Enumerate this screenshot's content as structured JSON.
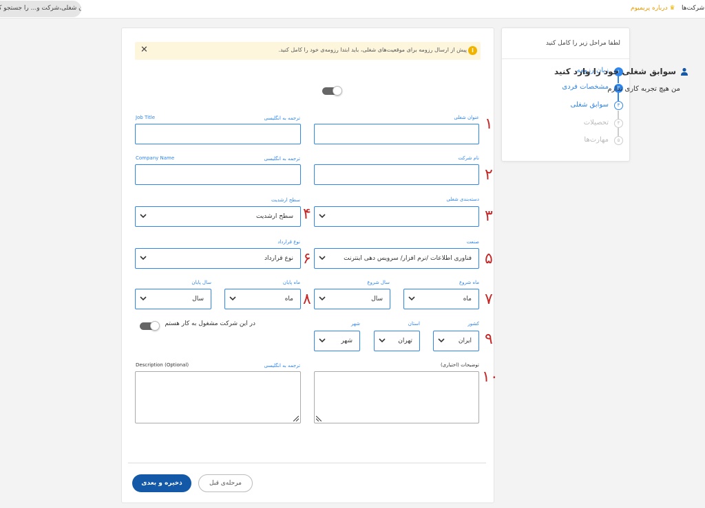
{
  "topbar": {
    "search_text": "عنوان شغلی،شرکت و... را جستجو کنید",
    "nav_companies": "شرکت‌ها",
    "premium_label": "درباره پریمیوم",
    "premium_icon": "crown-icon"
  },
  "steps": {
    "heading": "لطفا مراحل زیر را کامل کنید",
    "items": [
      {
        "num": "۱",
        "label": "زبان رزومه",
        "state": "done"
      },
      {
        "num": "۲",
        "label": "مشخصات فردی",
        "state": "done"
      },
      {
        "num": "۳",
        "label": "سوابق شغلی",
        "state": "current"
      },
      {
        "num": "۴",
        "label": "تحصیلات",
        "state": "todo"
      },
      {
        "num": "۵",
        "label": "مهارت‌ها",
        "state": "todo"
      }
    ]
  },
  "alert": {
    "text": "پیش از ارسال رزومه برای موقعیت‌های شغلی، باید ابتدا رزومه‌ی خود را کامل کنید.",
    "icon": "info-icon",
    "close": "✕"
  },
  "form": {
    "title": "سوابق شغلی خود را وارد کنید",
    "no_experience_label": "من هیچ تجربه کاری ندارم",
    "job_title_label": "عنوان شغلی",
    "job_title_en_label": "ترجمه به انگلیسی",
    "job_title_en_hint": "Job Title",
    "company_label": "نام شرکت",
    "company_en_label": "ترجمه به انگلیسی",
    "company_en_hint": "Company Name",
    "category_label": "دسته‌بندی شغلی",
    "seniority_label": "سطح ارشدیت",
    "seniority_value": "سطح ارشدیت",
    "industry_label": "صنعت",
    "industry_value": "فناوری اطلاعات /نرم افزار/ سرویس دهی اینترنت",
    "contract_label": "نوع قرارداد",
    "contract_value": "نوع قرارداد",
    "start_month_label": "ماه شروع",
    "start_month_value": "ماه",
    "start_year_label": "سال شروع",
    "start_year_value": "سال",
    "end_month_label": "ماه پایان",
    "end_month_value": "ماه",
    "end_year_label": "سال پایان",
    "end_year_value": "سال",
    "currently_working_label": "در این شرکت مشغول به کار هستم",
    "country_label": "کشور",
    "country_value": "ایران",
    "province_label": "استان",
    "province_value": "تهران",
    "city_label": "شهر",
    "city_value": "شهر",
    "description_label": "توضیحات (اختیاری)",
    "description_en_label": "ترجمه به انگلیسی",
    "description_en_hint": "Description (Optional)"
  },
  "annotations": [
    "۱",
    "۲",
    "۳",
    "۴",
    "۵",
    "۶",
    "۷",
    "۸",
    "۹",
    "۱۰"
  ],
  "buttons": {
    "save_next": "ذخیره و بعدی",
    "previous": "مرحله‌ی قبل"
  },
  "colors": {
    "accent": "#2f86ea",
    "primary_button": "#1458a8",
    "annotation_red": "#c62828",
    "alert_bg": "#fdf6dc",
    "premium": "#e89a00"
  }
}
